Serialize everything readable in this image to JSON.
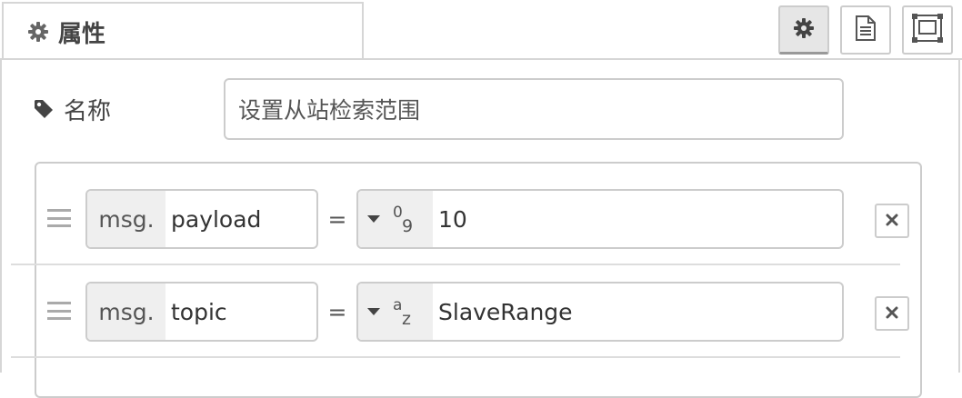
{
  "tab": {
    "label": "属性",
    "icon": "gear-icon"
  },
  "toolbar": {
    "buttons": [
      {
        "icon": "gear-icon",
        "active": true
      },
      {
        "icon": "document-icon",
        "active": false
      },
      {
        "icon": "layout-frame-icon",
        "active": false
      }
    ]
  },
  "name": {
    "label": "名称",
    "icon": "tag-icon",
    "value": "设置从站检索范围"
  },
  "rules": [
    {
      "prefix": "msg.",
      "property": "payload",
      "operator": "=",
      "type_icon": "number-type-icon",
      "type_glyph_top": "0",
      "type_glyph_bottom": "9",
      "value": "10"
    },
    {
      "prefix": "msg.",
      "property": "topic",
      "operator": "=",
      "type_icon": "string-type-icon",
      "type_glyph_top": "a",
      "type_glyph_bottom": "z",
      "value": "SlaveRange"
    }
  ],
  "colors": {
    "border": "#cccccc",
    "tab_line": "#d6d6d6",
    "addon_bg": "#efefef",
    "text": "#333333"
  }
}
